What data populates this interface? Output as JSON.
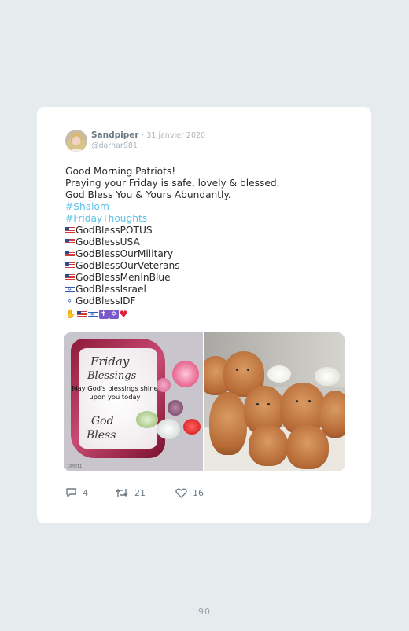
{
  "tweet": {
    "author_name": "Sandpiper",
    "separator": "·",
    "date": "31 janvier 2020",
    "handle": "@darhar981",
    "lines": [
      "Good Morning Patriots!",
      "Praying your Friday is safe, lovely & blessed.",
      "God Bless You & Yours Abundantly."
    ],
    "hashtags": [
      "#Shalom",
      "#FridayThoughts"
    ],
    "flag_lines": [
      {
        "flag": "us-flag",
        "text": "GodBlessPOTUS"
      },
      {
        "flag": "us-flag",
        "text": "GodBlessUSA"
      },
      {
        "flag": "us-flag",
        "text": "GodBlessOurMilitary"
      },
      {
        "flag": "us-flag",
        "text": "GodBlessOurVeterans"
      },
      {
        "flag": "us-flag",
        "text": "GodBlessMenInBlue"
      },
      {
        "flag": "israel-flag",
        "text": "GodBlessIsrael"
      },
      {
        "flag": "israel-flag",
        "text": "GodBlessIDF"
      }
    ],
    "emoji_row": [
      "praying-hands",
      "us-flag",
      "israel-flag",
      "cross",
      "star-of-david",
      "red-heart"
    ],
    "media": {
      "left_image": {
        "title_line1": "Friday",
        "title_line2": "Blessings",
        "message": "May God's blessings shine upon you today",
        "closing_line1": "God",
        "closing_line2": "Bless",
        "watermark": "10/5/11"
      },
      "right_image": {
        "subject": "puppies"
      }
    },
    "actions": {
      "reply_count": "4",
      "retweet_count": "21",
      "like_count": "16"
    }
  },
  "page_number": "90",
  "colors": {
    "background": "#e6ebee",
    "card": "#ffffff",
    "hashtag": "#5cc1e8",
    "meta": "#aab4bb"
  }
}
